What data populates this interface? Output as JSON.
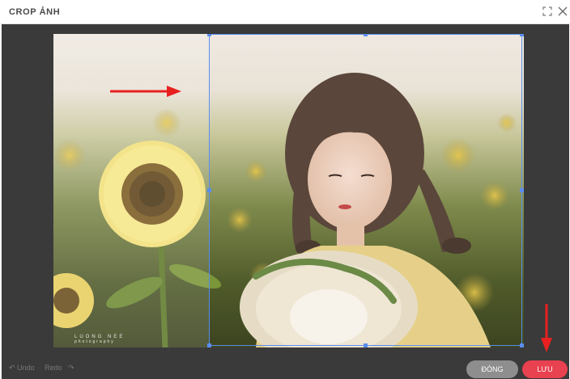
{
  "header": {
    "title": "CROP ẢNH",
    "expand_icon": "expand-icon",
    "close_icon": "close-icon"
  },
  "image": {
    "watermark_line1": "LUONG NEE",
    "watermark_line2": "photography"
  },
  "footer": {
    "undo_label": "Undo",
    "redo_label": "Redo",
    "close_button_label": "ĐÓNG",
    "save_button_label": "LƯU"
  },
  "colors": {
    "accent_save": "#e8414f",
    "close_button": "#8e8e8e",
    "crop_border": "#5a8dee",
    "stage_bg": "#3a3a3a",
    "annotation_arrow": "#e82020"
  }
}
